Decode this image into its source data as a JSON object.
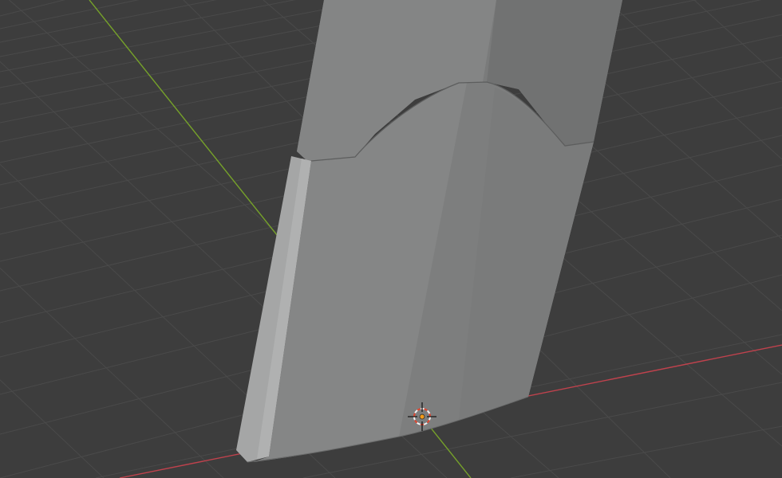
{
  "viewport": {
    "type": "3d-viewport",
    "background_color": "#3d3d3d",
    "grid_color": "#4a4a4a",
    "x_axis_color": "#c0424d",
    "y_axis_color": "#76a22a",
    "object_colors": {
      "front_face": "#858686",
      "side_face": "#a5a6a6",
      "back_panel": "#7a7b7b",
      "outline": "#5d5e5e"
    },
    "cursor": {
      "icon": "3d-cursor-icon",
      "ring_color_a": "#e0452f",
      "ring_color_b": "#f2f2f2"
    },
    "origin_color": "#f29b1b"
  }
}
